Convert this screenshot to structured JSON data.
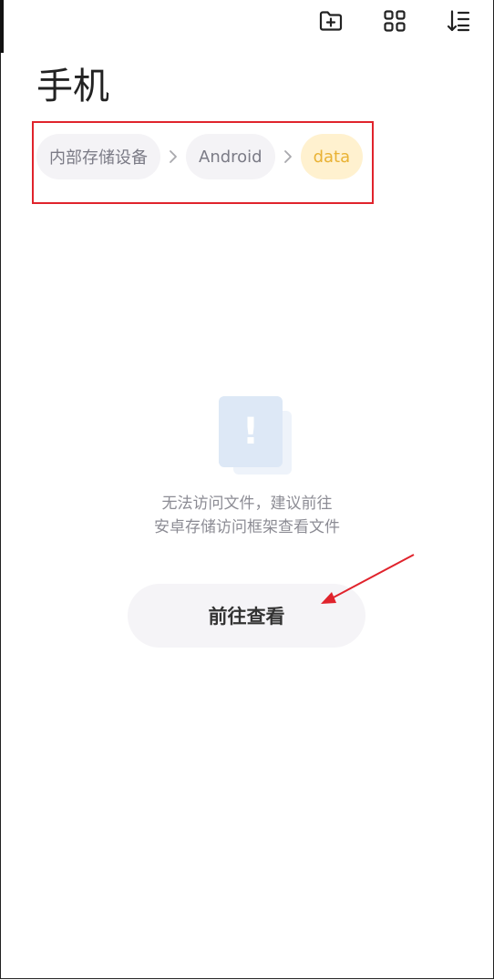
{
  "header": {
    "title": "手机",
    "icons": [
      "new-folder-icon",
      "grid-view-icon",
      "sort-icon"
    ]
  },
  "breadcrumb": {
    "items": [
      {
        "label": "内部存储设备",
        "active": false
      },
      {
        "label": "Android",
        "active": false
      },
      {
        "label": "data",
        "active": true
      }
    ]
  },
  "empty_state": {
    "icon": "warning-document-icon",
    "line1": "无法访问文件，建议前往",
    "line2": "安卓存储访问框架查看文件"
  },
  "action": {
    "button_label": "前往查看"
  },
  "colors": {
    "accent_active_text": "#e9b234",
    "accent_active_bg": "#fff1cf",
    "annotation_red": "#e0232c"
  }
}
